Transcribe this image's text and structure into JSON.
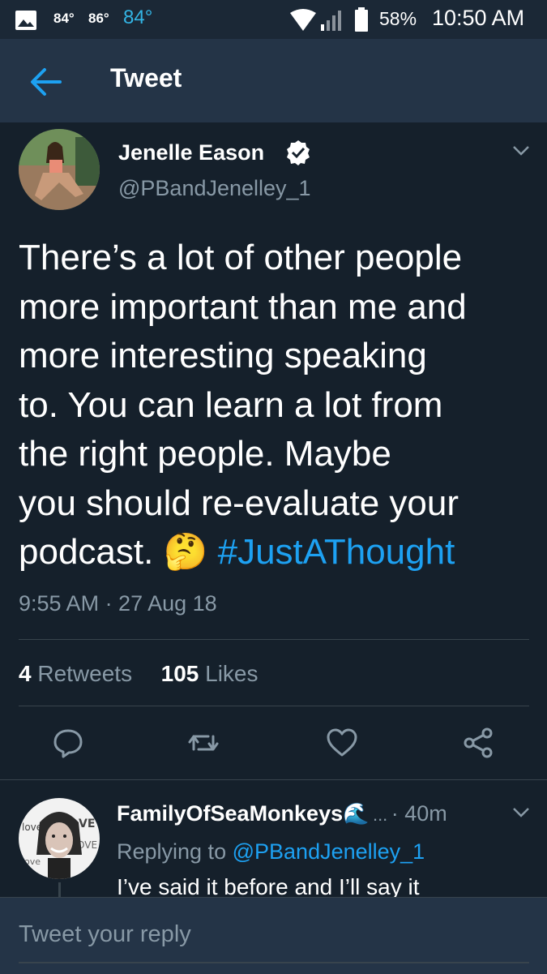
{
  "status_bar": {
    "temp1": "84°",
    "temp2": "86°",
    "temp3": "84°",
    "battery": "58%",
    "time": "10:50 AM"
  },
  "header": {
    "back_icon": "arrow-left-icon",
    "title": "Tweet"
  },
  "tweet": {
    "display_name": "Jenelle Eason",
    "verified_icon": "verified-badge-icon",
    "handle": "@PBandJenelley_1",
    "text_lines": [
      "There’s a lot of other people",
      "more important than me and",
      "more interesting speaking",
      "to. You can learn a lot from",
      "the right people. Maybe",
      "you should re-evaluate your"
    ],
    "last_line_text": "podcast.",
    "emoji": "🤔",
    "hashtag": "#JustAThought",
    "timestamp": "9:55 AM · 27 Aug 18",
    "retweets_count": "4",
    "retweets_label": "Retweets",
    "likes_count": "105",
    "likes_label": "Likes"
  },
  "actions": [
    "reply-icon",
    "retweet-icon",
    "like-icon",
    "share-icon"
  ],
  "reply": {
    "display_name": "FamilyOfSeaMonkeys",
    "name_emoji": "🌊",
    "ellipsis": "...",
    "time": "· 40m",
    "replying_prefix": "Replying to",
    "replying_handle": "@PBandJenelley_1",
    "text": "I’ve said it before and I’ll say it"
  },
  "composer": {
    "placeholder": "Tweet your reply"
  },
  "colors": {
    "background": "#15202b",
    "header": "#243447",
    "accent": "#1da1f2",
    "secondary_text": "#8899a6"
  }
}
